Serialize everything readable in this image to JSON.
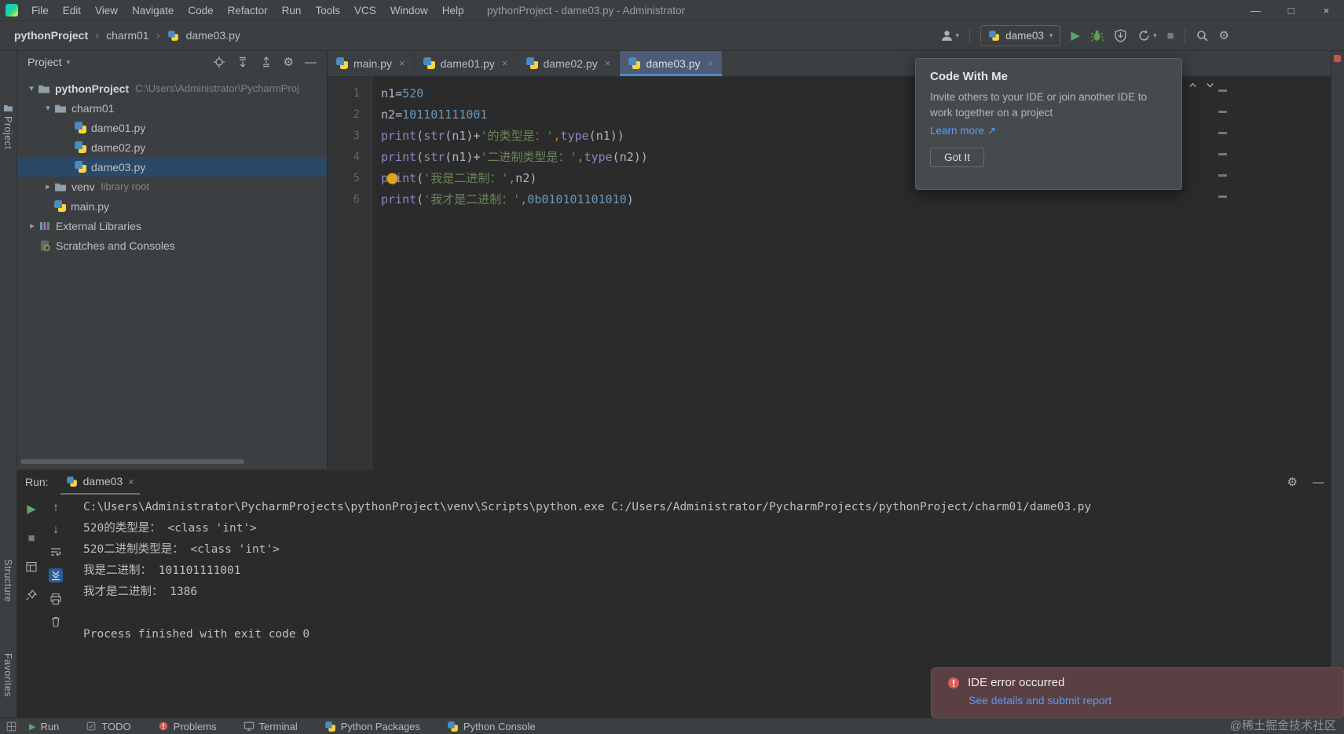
{
  "glyphs": {
    "dropdown": "▾",
    "expanded": "▾",
    "collapsed": "▸",
    "crumb_sep": "›",
    "close": "×",
    "minimize": "—",
    "maximize": "□",
    "play": "▶",
    "stop": "■",
    "gear": "⚙",
    "minus": "—",
    "up": "↑",
    "down": "↓",
    "link_arrow": "↗"
  },
  "titlebar": {
    "title": "pythonProject - dame03.py - Administrator",
    "menus": [
      "File",
      "Edit",
      "View",
      "Navigate",
      "Code",
      "Refactor",
      "Run",
      "Tools",
      "VCS",
      "Window",
      "Help"
    ]
  },
  "toolbar": {
    "breadcrumbs": [
      "pythonProject",
      "charm01",
      "dame03.py"
    ],
    "run_config": "dame03"
  },
  "tool_stripes": {
    "project": "Project",
    "structure": "Structure",
    "favorites": "Favorites"
  },
  "project_panel": {
    "title": "Project",
    "tree": [
      {
        "label": "pythonProject",
        "extra": "C:\\Users\\Administrator\\PycharmProj"
      },
      {
        "label": "charm01"
      },
      {
        "label": "dame01.py"
      },
      {
        "label": "dame02.py"
      },
      {
        "label": "dame03.py"
      },
      {
        "label": "venv",
        "extra": "library root"
      },
      {
        "label": "main.py"
      },
      {
        "label": "External Libraries"
      },
      {
        "label": "Scratches and Consoles"
      }
    ]
  },
  "editor": {
    "tabs": [
      "main.py",
      "dame01.py",
      "dame02.py",
      "dame03.py"
    ],
    "line_numbers": [
      "1",
      "2",
      "3",
      "4",
      "5",
      "6"
    ],
    "code": [
      [
        [
          "d",
          "n1"
        ],
        [
          "d",
          "="
        ],
        [
          "n",
          "520"
        ]
      ],
      [
        [
          "d",
          "n2"
        ],
        [
          "d",
          "="
        ],
        [
          "n",
          "101101111001"
        ]
      ],
      [
        [
          "b",
          "print"
        ],
        [
          "d",
          "("
        ],
        [
          "b",
          "str"
        ],
        [
          "d",
          "("
        ],
        [
          "d",
          "n1"
        ],
        [
          "d",
          ")"
        ],
        [
          "d",
          "+"
        ],
        [
          "s",
          "'的类型是："
        ],
        [
          "s",
          "'"
        ],
        [
          "k",
          ","
        ],
        [
          "b",
          "type"
        ],
        [
          "d",
          "("
        ],
        [
          "d",
          "n1"
        ],
        [
          "d",
          "))"
        ]
      ],
      [
        [
          "b",
          "print"
        ],
        [
          "d",
          "("
        ],
        [
          "b",
          "str"
        ],
        [
          "d",
          "("
        ],
        [
          "d",
          "n1"
        ],
        [
          "d",
          ")"
        ],
        [
          "d",
          "+"
        ],
        [
          "s",
          "'二进制类型是："
        ],
        [
          "s",
          "'"
        ],
        [
          "k",
          ","
        ],
        [
          "b",
          "type"
        ],
        [
          "d",
          "("
        ],
        [
          "d",
          "n2"
        ],
        [
          "d",
          "))"
        ]
      ],
      [
        [
          "b",
          "print"
        ],
        [
          "d",
          "("
        ],
        [
          "s",
          "'我是二进制："
        ],
        [
          "s",
          "'"
        ],
        [
          "k",
          ","
        ],
        [
          "d",
          "n2"
        ],
        [
          "d",
          ")"
        ]
      ],
      [
        [
          "b",
          "print"
        ],
        [
          "d",
          "("
        ],
        [
          "s",
          "'我才是二进制："
        ],
        [
          "s",
          "'"
        ],
        [
          "k",
          ","
        ],
        [
          "n",
          "0b010101101010"
        ],
        [
          "d",
          ")"
        ]
      ]
    ]
  },
  "popup": {
    "title": "Code With Me",
    "body": "Invite others to your IDE or join another IDE to work together on a project",
    "link": "Learn more",
    "button": "Got It"
  },
  "run_panel": {
    "label": "Run:",
    "tab": "dame03",
    "console": [
      "C:\\Users\\Administrator\\PycharmProjects\\pythonProject\\venv\\Scripts\\python.exe C:/Users/Administrator/PycharmProjects/pythonProject/charm01/dame03.py",
      "520的类型是： <class 'int'>",
      "520二进制类型是： <class 'int'>",
      "我是二进制： 101101111001",
      "我才是二进制： 1386",
      "",
      "Process finished with exit code 0"
    ]
  },
  "status_bar": {
    "items": [
      "Run",
      "TODO",
      "Problems",
      "Terminal",
      "Python Packages",
      "Python Console"
    ]
  },
  "notification": {
    "title": "IDE error occurred",
    "link": "See details and submit report"
  },
  "watermark": "@稀土掘金技术社区"
}
